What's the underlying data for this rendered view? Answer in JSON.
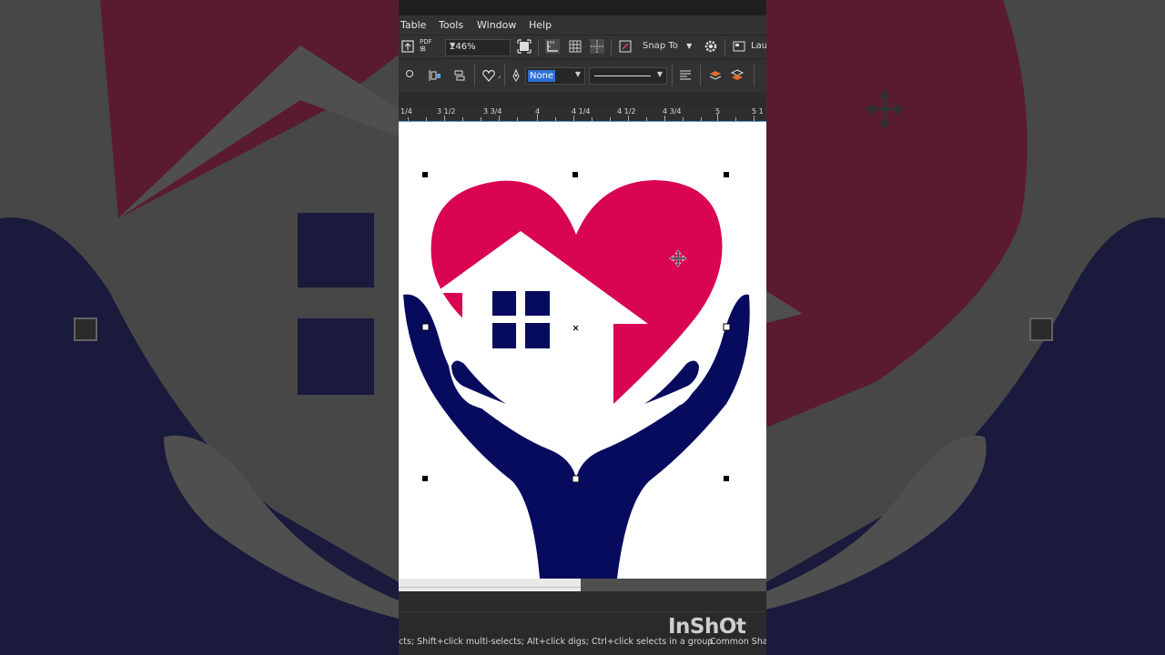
{
  "menu": {
    "items": [
      "Table",
      "Tools",
      "Window",
      "Help"
    ]
  },
  "toolbar": {
    "pdf_label": "PDF",
    "zoom_value": "246%",
    "snap_to_label": "Snap To",
    "launch_label": "Lau",
    "outline_width_value": "None"
  },
  "ruler": {
    "labels": [
      "1/4",
      "3 1/2",
      "3 3/4",
      "4",
      "4 1/4",
      "4 1/2",
      "4 3/4",
      "5",
      "5 1"
    ]
  },
  "status": {
    "hint": "cts; Shift+click multi-selects; Alt+click digs; Ctrl+click selects in a group",
    "right": "Common Sha"
  },
  "watermark": "InShOt",
  "colors": {
    "heart": "#d90452",
    "hands": "#070b5e",
    "window": "#070b5e",
    "house": "#ffffff",
    "selection_blue": "#2f6fd6"
  },
  "icons": [
    "import-icon",
    "pdf-icon",
    "full-screen-icon",
    "show-rulers-icon",
    "show-grid-icon",
    "show-guidelines-icon",
    "snap-icon",
    "options-gear-icon",
    "launch-icon",
    "node-icon",
    "align-icon",
    "heart-shape-icon",
    "pen-outline-icon",
    "text-wrap-icon",
    "to-front-icon",
    "to-back-icon",
    "move-cursor-icon"
  ]
}
